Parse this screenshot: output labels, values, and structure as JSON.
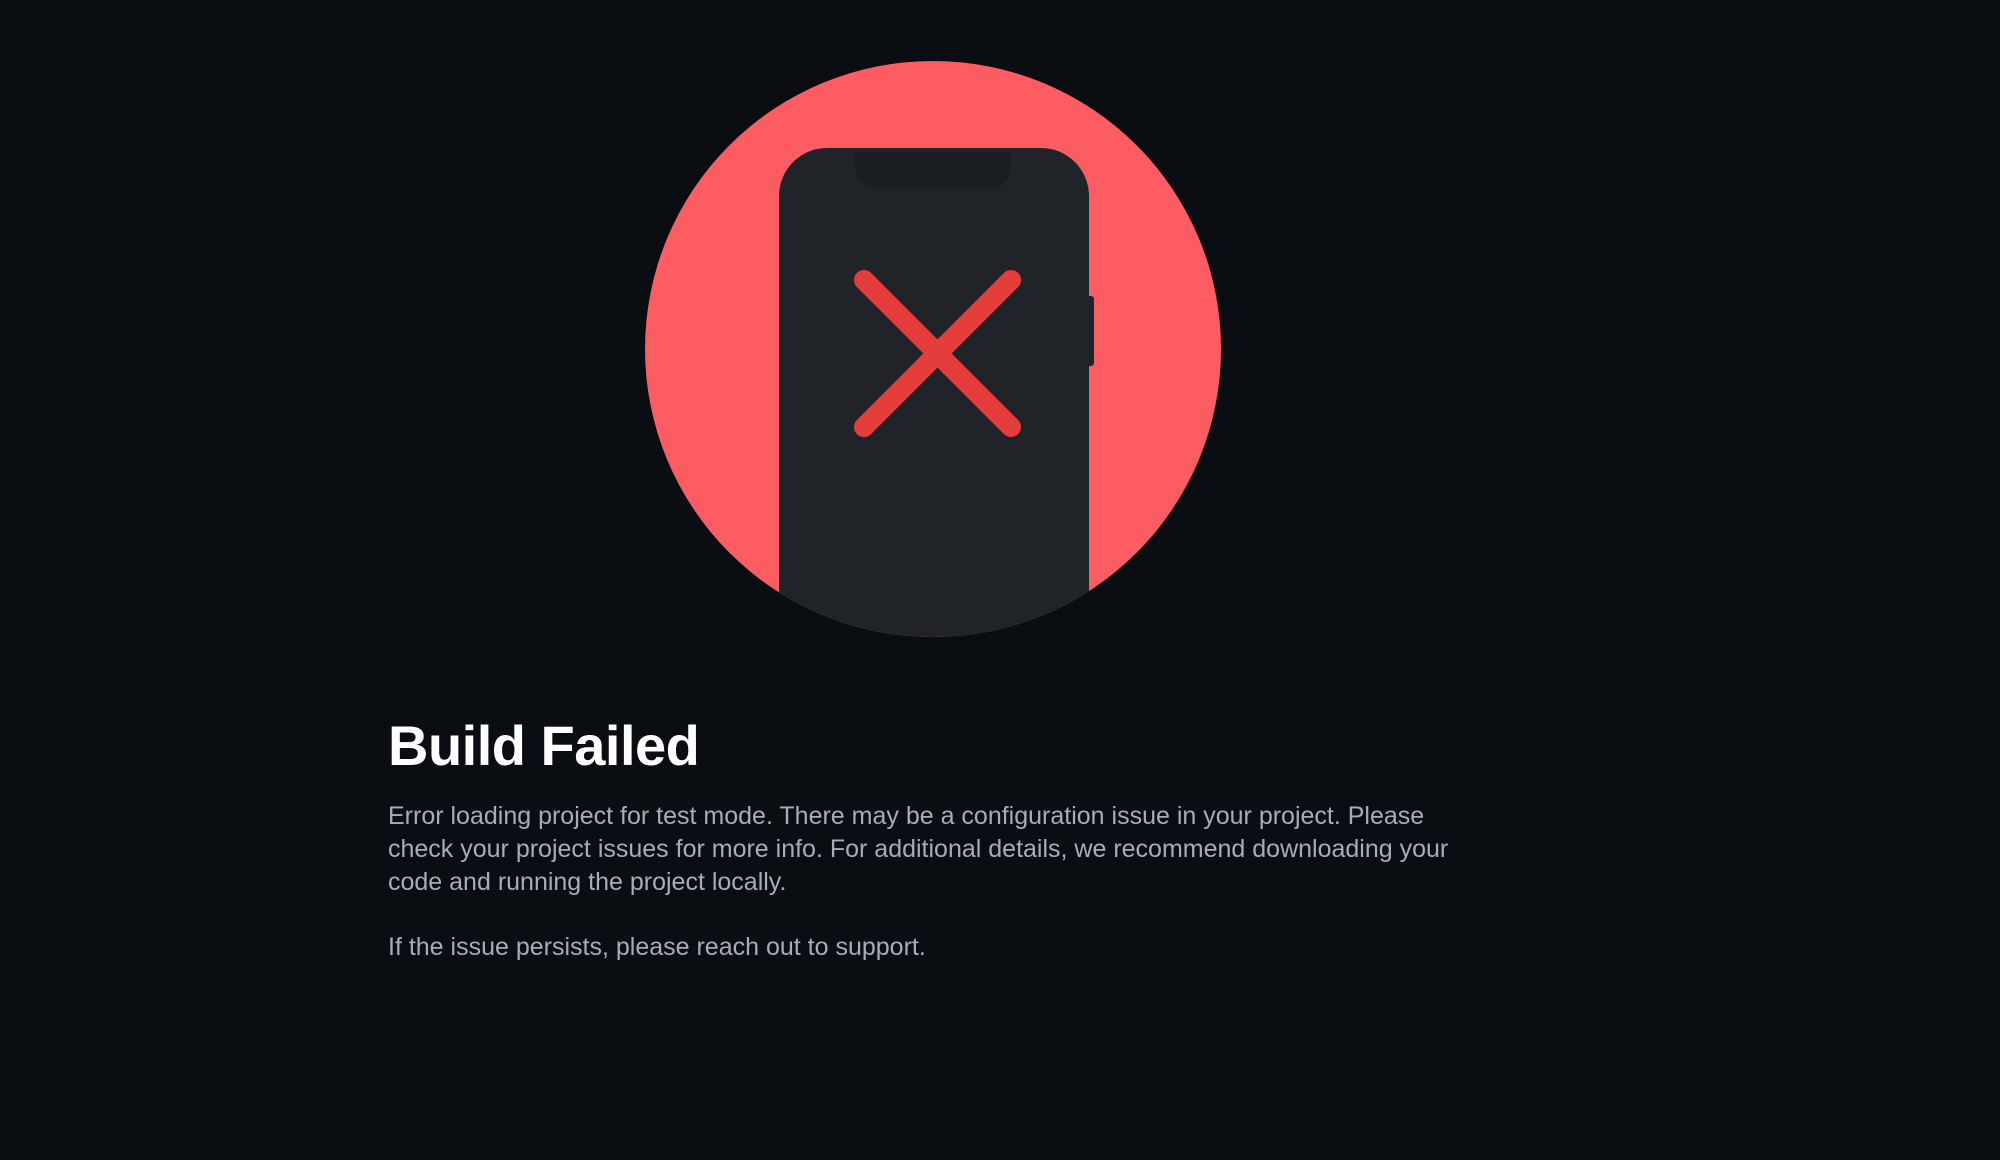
{
  "icons": {
    "illustration": "phone-with-error-x-icon"
  },
  "colors": {
    "background": "#0a0e13",
    "circle": "#fd5c63",
    "phone": "#202428",
    "error_x": "#e53c3c",
    "title": "#ffffff",
    "body_text": "#a9adb3"
  },
  "error": {
    "title": "Build Failed",
    "message": "Error loading project for test mode. There may be a configuration issue in your project. Please check your project issues for more info. For additional details, we recommend downloading your code and running the project locally.",
    "support": "If the issue persists, please reach out to support."
  }
}
